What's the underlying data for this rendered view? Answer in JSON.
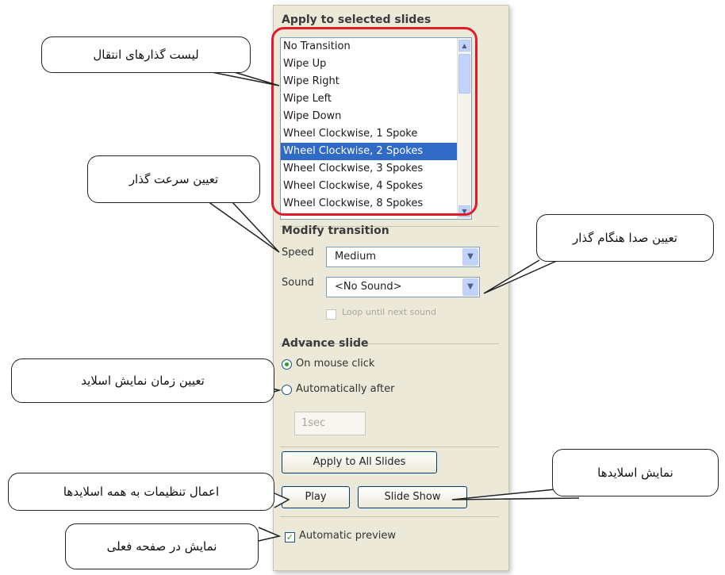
{
  "pane": {
    "apply_title": "Apply to selected slides",
    "transitions": [
      "No Transition",
      "Wipe Up",
      "Wipe Right",
      "Wipe Left",
      "Wipe Down",
      "Wheel Clockwise, 1 Spoke",
      "Wheel Clockwise, 2 Spokes",
      "Wheel Clockwise, 3 Spokes",
      "Wheel Clockwise, 4 Spokes",
      "Wheel Clockwise, 8 Spokes"
    ],
    "modify_title": "Modify transition",
    "speed_label": "Speed",
    "speed_value": "Medium",
    "sound_label": "Sound",
    "sound_value": "<No Sound>",
    "loop_label": "Loop until next sound",
    "advance_title": "Advance slide",
    "on_mouse_click": "On mouse click",
    "automatically_after": "Automatically after",
    "time_value": "1sec",
    "apply_all": "Apply to All Slides",
    "play": "Play",
    "slide_show": "Slide Show",
    "automatic_preview": "Automatic preview"
  },
  "callouts": {
    "transition_list": "لیست گذارهای انتقال",
    "speed": "تعیین سرعت گذار",
    "sound": "تعیین صدا هنگام گذار",
    "timing": "تعیین زمان نمایش اسلاید",
    "apply_all": "اعمال تنظیمات به همه اسلایدها",
    "slide_show": "نمایش اسلایدها",
    "preview": "نمایش در صفحه فعلی"
  },
  "colors": {
    "highlight": "#316ac5",
    "outline": "#e21b2b",
    "pane_bg": "#ece9d8"
  }
}
